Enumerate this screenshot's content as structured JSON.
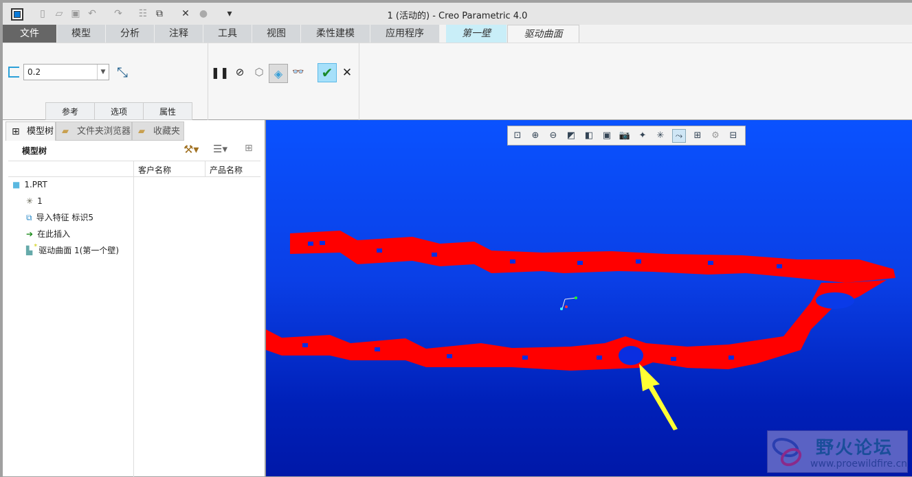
{
  "window": {
    "title": "1 (活动的) - Creo Parametric 4.0"
  },
  "tabs": [
    {
      "label": "文件"
    },
    {
      "label": "模型"
    },
    {
      "label": "分析"
    },
    {
      "label": "注释"
    },
    {
      "label": "工具"
    },
    {
      "label": "视图"
    },
    {
      "label": "柔性建模"
    },
    {
      "label": "应用程序"
    },
    {
      "label": "第一壁"
    },
    {
      "label": "驱动曲面"
    }
  ],
  "ribbon": {
    "thickness_value": "0.2",
    "subtabs": [
      "参考",
      "选项",
      "属性"
    ]
  },
  "panel": {
    "tabs": [
      "模型树",
      "文件夹浏览器",
      "收藏夹"
    ],
    "header": "模型树",
    "columns": [
      "客户名称",
      "产品名称"
    ],
    "items": [
      {
        "label": "1.PRT",
        "icon": "part-icon"
      },
      {
        "label": "1",
        "icon": "csys-icon"
      },
      {
        "label": "导入特征 标识5",
        "icon": "import-feature-icon"
      },
      {
        "label": "在此插入",
        "icon": "insert-here-arrow-icon"
      },
      {
        "label": "驱动曲面 1(第一个壁)",
        "icon": "driving-surface-icon",
        "marker": "*"
      }
    ]
  },
  "watermark": {
    "name": "野火论坛",
    "url": "www.proewildfire.cn"
  },
  "colors": {
    "model": "#ff0000",
    "arrow": "#ffff33",
    "background": "#0a44f0"
  }
}
